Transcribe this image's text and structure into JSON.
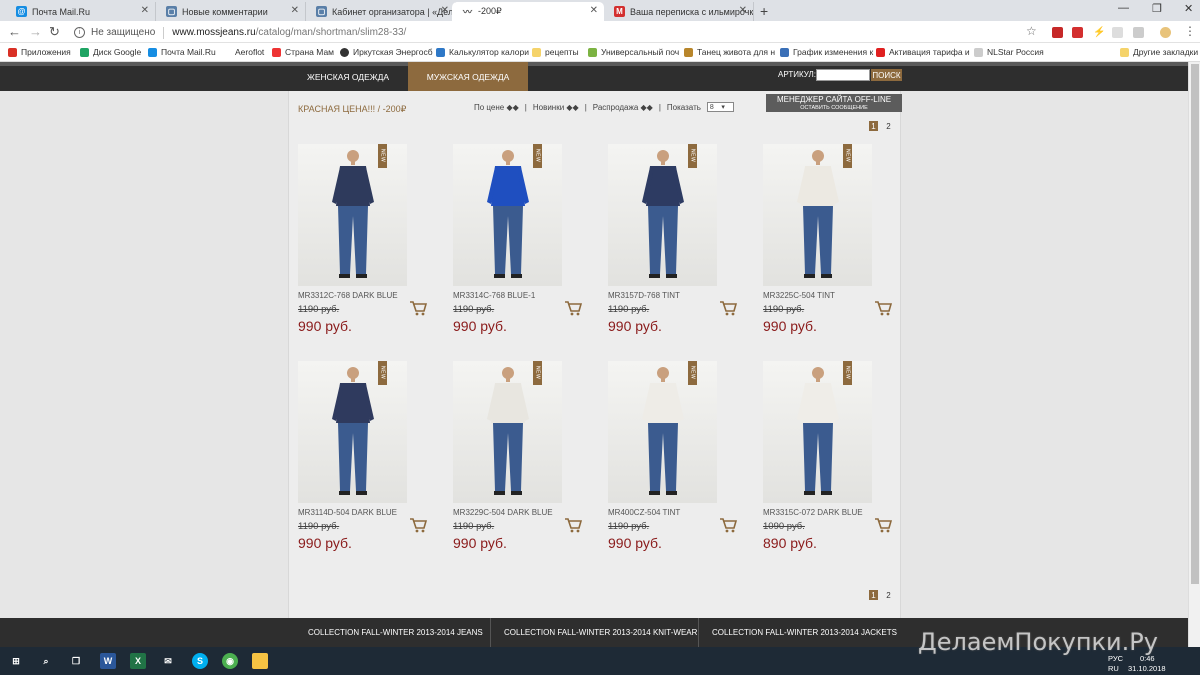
{
  "browser": {
    "tabs": [
      {
        "title": "Почта Mail.Ru",
        "icon": "mail-icon",
        "active": false
      },
      {
        "title": "Новые комментарии",
        "icon": "page-icon",
        "active": false
      },
      {
        "title": "Кабинет организатора | «Делае",
        "icon": "page-icon",
        "active": false
      },
      {
        "title": "-200₽",
        "icon": "mossjeans-icon",
        "active": true
      },
      {
        "title": "Ваша переписка с ильмирочкак",
        "icon": "mail-m-icon",
        "active": false
      }
    ],
    "new_tab": "+",
    "address": {
      "security": "Не защищено",
      "host": "www.mossjeans.ru",
      "path": "/catalog/man/shortman/slim28-33/"
    },
    "bookmarks": [
      {
        "label": "Приложения",
        "icon": "apps-icon",
        "color": "#d93025"
      },
      {
        "label": "Диск Google",
        "icon": "google-drive-icon",
        "color": "#1fa463"
      },
      {
        "label": "Почта Mail.Ru",
        "icon": "mail-icon",
        "color": "#168de2"
      },
      {
        "label": "Aeroflot",
        "icon": "aeroflot-icon",
        "color": "#ffffff"
      },
      {
        "label": "Страна Мам",
        "icon": "strana-mam-icon",
        "color": "#e33"
      },
      {
        "label": "Иркутская Энергосб",
        "icon": "energy-icon",
        "color": "#333"
      },
      {
        "label": "Калькулятор калори",
        "icon": "calculator-icon",
        "color": "#2e78c7"
      },
      {
        "label": "рецепты",
        "icon": "folder-icon",
        "color": "#f5d36a"
      },
      {
        "label": "Универсальный поч",
        "icon": "post-icon",
        "color": "#7cb342"
      },
      {
        "label": "Танец живота для н",
        "icon": "dance-icon",
        "color": "#b8862b"
      },
      {
        "label": "График изменения к",
        "icon": "chart-icon",
        "color": "#3a6fb7"
      },
      {
        "label": "Активация тарифа и",
        "icon": "tariff-icon",
        "color": "#e02020"
      },
      {
        "label": "NLStar Россия",
        "icon": "page-icon",
        "color": "#cccccc"
      }
    ],
    "other_bookmarks": "Другие закладки"
  },
  "site": {
    "nav": [
      "Женская одежда",
      "Мужская одежда"
    ],
    "article_label": "АРТИКУЛ:",
    "search_button": "ПОИСК",
    "promo_title": "КРАСНАЯ ЦЕНА!!! / -200₽",
    "sort": {
      "by_price": "По цене ◆◆",
      "new": "Новинки ◆◆",
      "sale": "Распродажа ◆◆",
      "show_label": "Показать",
      "show_value": "8"
    },
    "manager": {
      "title": "МЕНЕДЖЕР САЙТА OFF-LINE",
      "subtitle": "ОСТАВИТЬ СООБЩЕНИЕ"
    },
    "pages": [
      "1",
      "2"
    ],
    "new_badge": "NEW",
    "products": [
      {
        "sku": "MR3312C-768 DARK BLUE",
        "old_price": "1190 руб.",
        "price": "990 руб.",
        "shirt": "#2e3a5c"
      },
      {
        "sku": "MR3314C-768 BLUE-1",
        "old_price": "1190 руб.",
        "price": "990 руб.",
        "shirt": "#1f4fc0"
      },
      {
        "sku": "MR3157D-768 TINT",
        "old_price": "1190 руб.",
        "price": "990 руб.",
        "shirt": "#2d3b62"
      },
      {
        "sku": "MR3225C-504 TINT",
        "old_price": "1190 руб.",
        "price": "990 руб.",
        "shirt": "#ece9e2"
      },
      {
        "sku": "MR3114D-504 DARK BLUE",
        "old_price": "1190 руб.",
        "price": "990 руб.",
        "shirt": "#2f3a5e"
      },
      {
        "sku": "MR3229C-504 DARK BLUE",
        "old_price": "1190 руб.",
        "price": "990 руб.",
        "shirt": "#e8e6e0"
      },
      {
        "sku": "MR400CZ-504 TINT",
        "old_price": "1190 руб.",
        "price": "990 руб.",
        "shirt": "#eeece7"
      },
      {
        "sku": "MR3315C-072 DARK BLUE",
        "old_price": "1090 руб.",
        "price": "890 руб.",
        "shirt": "#efede8"
      }
    ],
    "footer_links": [
      "COLLECTION FALL-WINTER 2013-2014 JEANS",
      "COLLECTION FALL-WINTER 2013-2014 KNIT-WEAR",
      "COLLECTION FALL-WINTER 2013-2014 JACKETS"
    ],
    "watermark": "ДелаемПокупки.Ру"
  },
  "taskbar": {
    "lang": "РУС",
    "lang2": "RU",
    "time": "0:46",
    "date": "31.10.2018",
    "apps": [
      "windows-start-icon",
      "search-icon",
      "task-view-icon",
      "word-icon",
      "excel-icon",
      "mail-app-icon",
      "skype-icon",
      "chrome-icon",
      "file-explorer-icon"
    ]
  },
  "colors": {
    "accent": "#8d6a3e",
    "price": "#8a1a1a",
    "bar": "#2e2e2e"
  }
}
